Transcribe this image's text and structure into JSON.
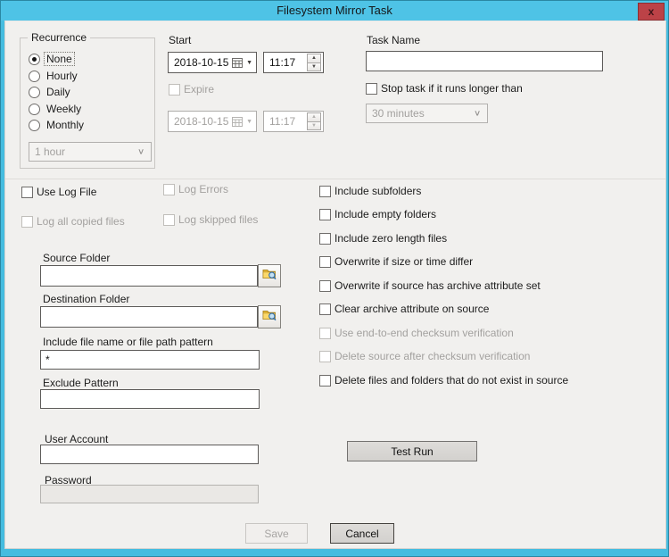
{
  "window": {
    "title": "Filesystem Mirror Task",
    "close_label": "x"
  },
  "recurrence": {
    "group_label": "Recurrence",
    "options": [
      {
        "label": "None",
        "selected": true
      },
      {
        "label": "Hourly",
        "selected": false
      },
      {
        "label": "Daily",
        "selected": false
      },
      {
        "label": "Weekly",
        "selected": false
      },
      {
        "label": "Monthly",
        "selected": false
      }
    ],
    "interval_value": "1 hour"
  },
  "start": {
    "label": "Start",
    "date_value": "2018-10-15",
    "time_value": "11:17",
    "expire_label": "Expire",
    "expire_date_value": "2018-10-15",
    "expire_time_value": "11:17"
  },
  "task": {
    "name_label": "Task Name",
    "name_value": "",
    "stop_checkbox_label": "Stop task if it runs longer than",
    "timeout_value": "30 minutes"
  },
  "logging": {
    "items": [
      {
        "label": "Use Log File",
        "enabled": true
      },
      {
        "label": "Log Errors",
        "enabled": false
      },
      {
        "label": "Log all copied files",
        "enabled": false
      },
      {
        "label": "Log skipped files",
        "enabled": false
      }
    ]
  },
  "options": {
    "items": [
      {
        "label": "Include subfolders",
        "enabled": true
      },
      {
        "label": "Include empty folders",
        "enabled": true
      },
      {
        "label": "Include zero length files",
        "enabled": true
      },
      {
        "label": "Overwrite if size or time differ",
        "enabled": true
      },
      {
        "label": "Overwrite if source has archive attribute set",
        "enabled": true
      },
      {
        "label": "Clear archive attribute on source",
        "enabled": true
      },
      {
        "label": "Use end-to-end checksum verification",
        "enabled": false
      },
      {
        "label": "Delete source after checksum verification",
        "enabled": false
      },
      {
        "label": "Delete files and folders that do not exist in source",
        "enabled": true
      }
    ]
  },
  "folders": {
    "source_label": "Source Folder",
    "source_value": "",
    "destination_label": "Destination Folder",
    "destination_value": "",
    "include_pattern_label": "Include file name or file path pattern",
    "include_pattern_value": "*",
    "exclude_pattern_label": "Exclude Pattern",
    "exclude_pattern_value": ""
  },
  "credentials": {
    "user_label": "User Account",
    "user_value": "",
    "password_label": "Password",
    "password_value": ""
  },
  "actions": {
    "test_run": "Test Run",
    "save": "Save",
    "cancel": "Cancel"
  }
}
